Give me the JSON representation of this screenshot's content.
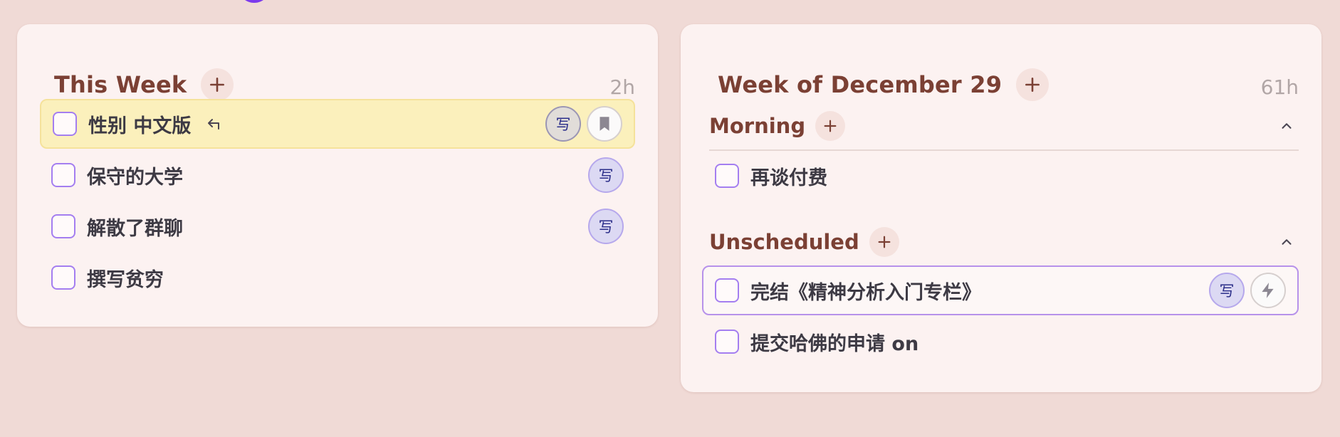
{
  "left_card": {
    "title": "This Week",
    "hours": "2h",
    "tasks": [
      {
        "title": "性别 中文版",
        "write_label": "写"
      },
      {
        "title": "保守的大学",
        "write_label": "写"
      },
      {
        "title": "解散了群聊",
        "write_label": "写"
      },
      {
        "title": "撰写贫穷"
      }
    ]
  },
  "right_card": {
    "title": "Week of December 29",
    "hours": "61h",
    "sections": [
      {
        "title": "Morning",
        "tasks": [
          {
            "title": "再谈付费"
          }
        ]
      },
      {
        "title": "Unscheduled",
        "tasks": [
          {
            "title": "完结《精神分析入门专栏》",
            "write_label": "写"
          },
          {
            "title": "提交哈佛的申请 on"
          }
        ]
      }
    ]
  },
  "icons": [
    "plus-icon",
    "defer-icon",
    "bookmark-icon",
    "lightning-icon",
    "chevron-up-icon"
  ],
  "colors": {
    "background": "#f0dad6",
    "card": "#fcf2f1",
    "title": "#7b4034",
    "accent": "#a47ef0",
    "highlight": "#fbf0bc"
  }
}
